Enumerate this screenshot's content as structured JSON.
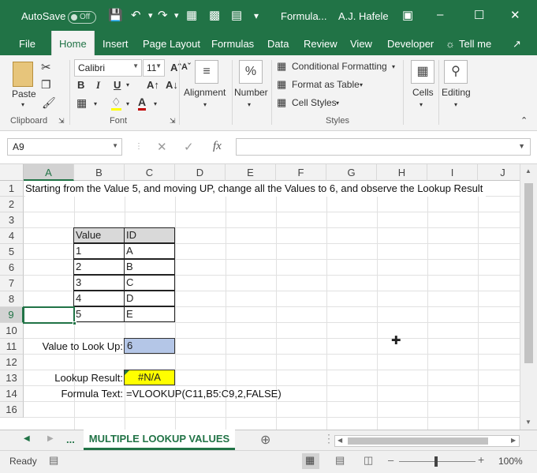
{
  "titlebar": {
    "autosave": "AutoSave",
    "toggle_state": "Off",
    "filename": "Formula...",
    "user": "A.J. Hafele"
  },
  "tabs": [
    "File",
    "Home",
    "Insert",
    "Page Layout",
    "Formulas",
    "Data",
    "Review",
    "View",
    "Developer",
    "Tell me"
  ],
  "ribbon": {
    "clipboard": {
      "paste": "Paste",
      "label": "Clipboard"
    },
    "font": {
      "name": "Calibri",
      "size": "11",
      "label": "Font",
      "bold": "B",
      "italic": "I",
      "underline": "U"
    },
    "alignment": "Alignment",
    "number": "Number",
    "styles": {
      "conditional": "Conditional Formatting",
      "table": "Format as Table",
      "cell_styles": "Cell Styles",
      "label": "Styles"
    },
    "cells": "Cells",
    "editing": "Editing"
  },
  "formula_bar": {
    "name_box": "A9",
    "fx": "fx",
    "value": ""
  },
  "grid": {
    "columns": [
      "A",
      "B",
      "C",
      "D",
      "E",
      "F",
      "G",
      "H",
      "I",
      "J"
    ],
    "rows": [
      "1",
      "2",
      "3",
      "4",
      "5",
      "6",
      "7",
      "8",
      "9",
      "10",
      "11",
      "12",
      "13",
      "14",
      "16"
    ],
    "row1_text": "Starting from the Value 5, and moving UP, change all the Values to 6, and observe the Lookup Result",
    "table_headers": [
      "Value",
      "ID"
    ],
    "table_rows": [
      [
        "1",
        "A"
      ],
      [
        "2",
        "B"
      ],
      [
        "3",
        "C"
      ],
      [
        "4",
        "D"
      ],
      [
        "5",
        "E"
      ]
    ],
    "lookup_label": "Value to Look Up:",
    "lookup_value": "6",
    "result_label": "Lookup Result:",
    "result_value": "#N/A",
    "formula_label": "Formula Text:",
    "formula_text": "=VLOOKUP(C11,B5:C9,2,FALSE)"
  },
  "sheet": {
    "ellipsis": "...",
    "name": "MULTIPLE LOOKUP VALUES"
  },
  "status": {
    "ready": "Ready",
    "zoom": "100%"
  },
  "colors": {
    "brand": "#217346",
    "lookup_fill": "#b4c6e7",
    "result_fill": "#ffff00"
  }
}
